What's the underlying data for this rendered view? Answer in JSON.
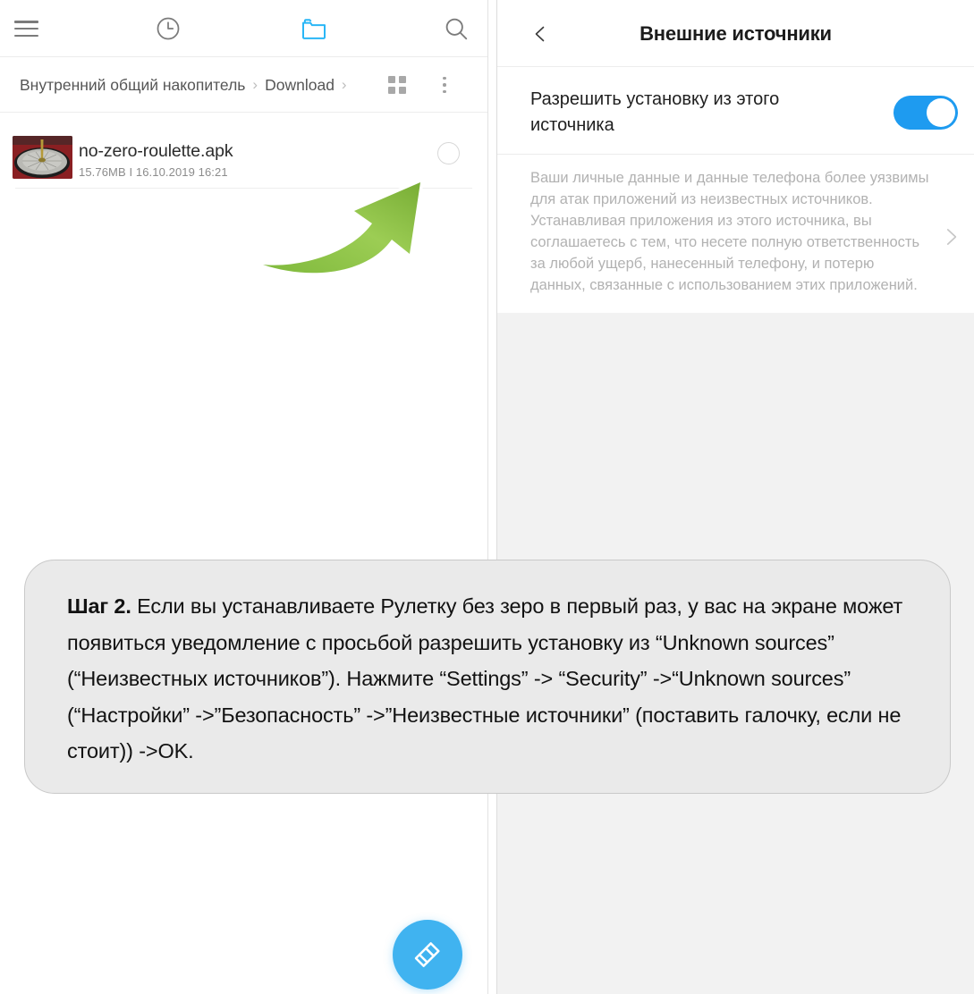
{
  "file_manager": {
    "toolbar": {
      "menu_icon": "hamburger-menu-icon",
      "recent_icon": "clock-recent-icon",
      "folder_icon": "folder-icon",
      "search_icon": "search-icon"
    },
    "breadcrumb": {
      "root_label": "Внутренний общий накопитель",
      "separator": "›",
      "folder_label": "Download",
      "trailing_separator": "›",
      "grid_icon": "grid-view-icon",
      "more_icon": "overflow-menu-icon"
    },
    "file": {
      "name": "no-zero-roulette.apk",
      "size": "15.76MB",
      "meta_separator": "I",
      "date": "16.10.2019 16:21",
      "meta": "15.76MB  I  16.10.2019 16:21",
      "thumbnail_icon": "roulette-wheel-thumbnail",
      "select_icon": "select-circle-icon"
    },
    "fab": {
      "icon": "cleaner-brush-icon"
    },
    "annotation": {
      "arrow_icon": "green-curved-arrow-icon",
      "arrow_color": "#8cc63f"
    }
  },
  "settings": {
    "header": {
      "back_icon": "back-chevron-icon",
      "title": "Внешние источники"
    },
    "permission": {
      "label": "Разрешить установку из этого источника",
      "toggle_state": "on",
      "toggle_color": "#1e9bf0"
    },
    "description": {
      "text": "Ваши личные данные и данные телефона более уязвимы для атак приложений из неизвестных источников. Устанавливая приложения из этого источника, вы соглашаетесь с тем, что несете полную ответственность за любой ущерб, нанесенный телефону, и потерю данных, связанные с использованием этих приложений.",
      "chevron_icon": "chevron-right-icon"
    }
  },
  "callout": {
    "step_label": "Шаг 2.",
    "body": " Если вы устанавливаете Рулетку без зеро в первый раз, у вас на экране может появиться уведомление с просьбой разрешить установку из “Unknown sources” (“Неизвестных источников”). Нажмите “Settings” -> “Security” ->“Unknown sources” (“Настройки” ->”Безопасность” ->”Неизвестные источники” (поставить галочку, если не стоит)) ->OK."
  },
  "colors": {
    "accent_blue": "#1e9bf0",
    "fab_blue": "#40b3f0",
    "arrow_green": "#8cc63f",
    "panel_bg": "#f2f2f2",
    "callout_bg": "#eaeaea"
  }
}
